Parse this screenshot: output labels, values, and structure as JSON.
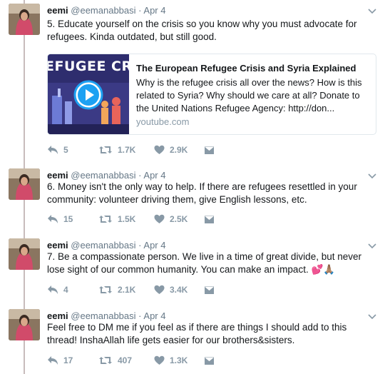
{
  "tweets": [
    {
      "name": "eemi",
      "handle": "@eemanabbasi",
      "dot": "·",
      "date": "Apr 4",
      "text": "5. Educate yourself on the crisis so you know why you must advocate for refugees. Kinda outdated, but still good.",
      "card": {
        "thumb_text": "EFUGEE CRIS",
        "title": "The European Refugee Crisis and Syria Explained",
        "description": "Why is the refugee crisis all over the news? How is this related to Syria? Why should we care at all? Donate to the United Nations Refugee Agency: http://don...",
        "domain": "youtube.com"
      },
      "replies": "5",
      "retweets": "1.7K",
      "likes": "2.9K"
    },
    {
      "name": "eemi",
      "handle": "@eemanabbasi",
      "dot": "·",
      "date": "Apr 4",
      "text": "6. Money isn't the only way to help. If there are refugees resettled in your community: volunteer driving them, give English lessons, etc.",
      "replies": "15",
      "retweets": "1.5K",
      "likes": "2.5K"
    },
    {
      "name": "eemi",
      "handle": "@eemanabbasi",
      "dot": "·",
      "date": "Apr 4",
      "text": "7. Be a compassionate person. We live in a time of great divide, but never lose sight of our common humanity. You can make an impact. 💕🙏🏽",
      "replies": "4",
      "retweets": "2.1K",
      "likes": "3.4K"
    },
    {
      "name": "eemi",
      "handle": "@eemanabbasi",
      "dot": "·",
      "date": "Apr 4",
      "text": "Feel free to DM me if you feel as if there are things I should add to this thread! InshaAllah life gets easier for our brothers&sisters.",
      "replies": "17",
      "retweets": "407",
      "likes": "1.3K"
    }
  ],
  "colors": {
    "thread_line": "#c8bcbc",
    "secondary_text": "#657786",
    "action_icon": "#8899a6",
    "card_border": "#e1e8ed"
  },
  "icons": [
    "chevron-down-icon",
    "reply-icon",
    "retweet-icon",
    "like-icon",
    "message-icon",
    "play-icon"
  ]
}
